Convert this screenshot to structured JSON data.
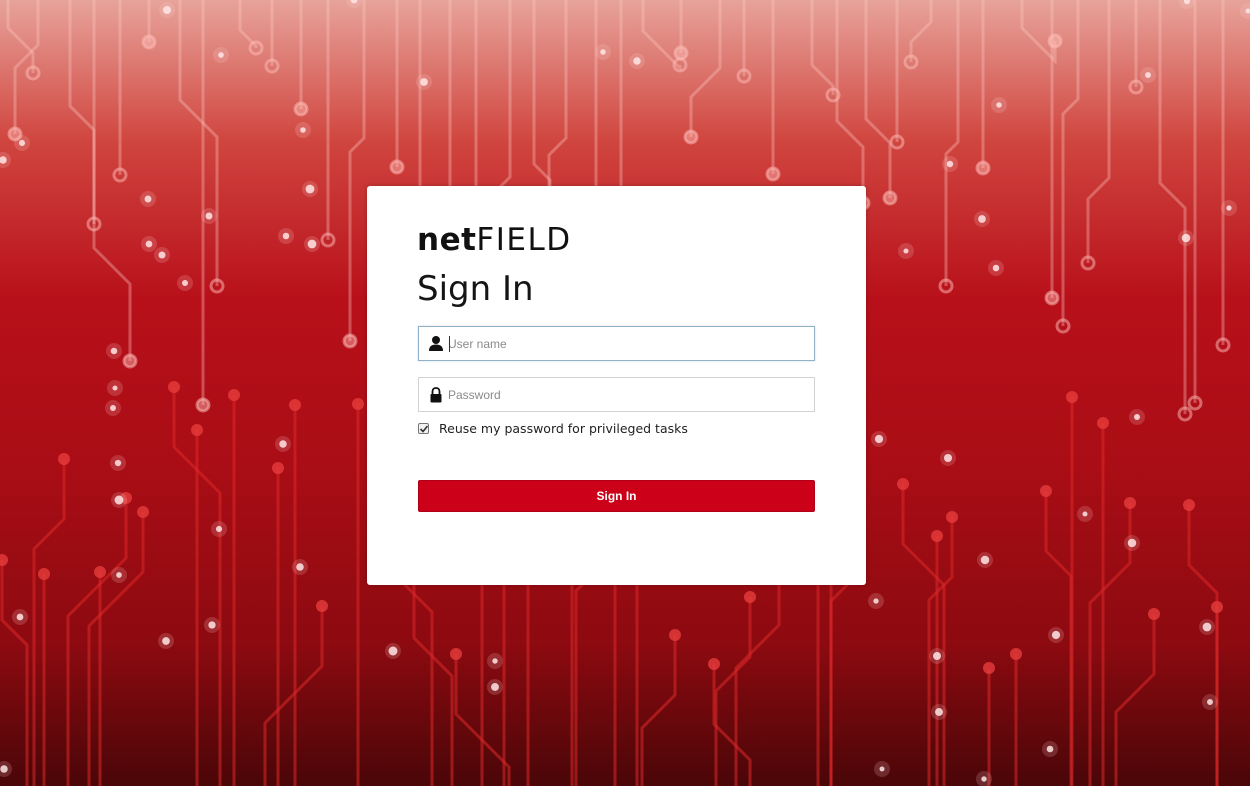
{
  "brand": {
    "logo_bold": "net",
    "logo_light": "FIELD"
  },
  "form": {
    "title": "Sign In",
    "username_placeholder": "User name",
    "password_placeholder": "Password",
    "reuse_password_label": "Reuse my password for privileged tasks",
    "reuse_password_checked": true,
    "submit_label": "Sign In"
  },
  "icons": {
    "username": "user-icon",
    "password": "lock-icon",
    "checkbox": "checkmark-icon"
  },
  "colors": {
    "accent": "#cc0018",
    "background_dark": "#a90d15",
    "card": "#ffffff"
  }
}
